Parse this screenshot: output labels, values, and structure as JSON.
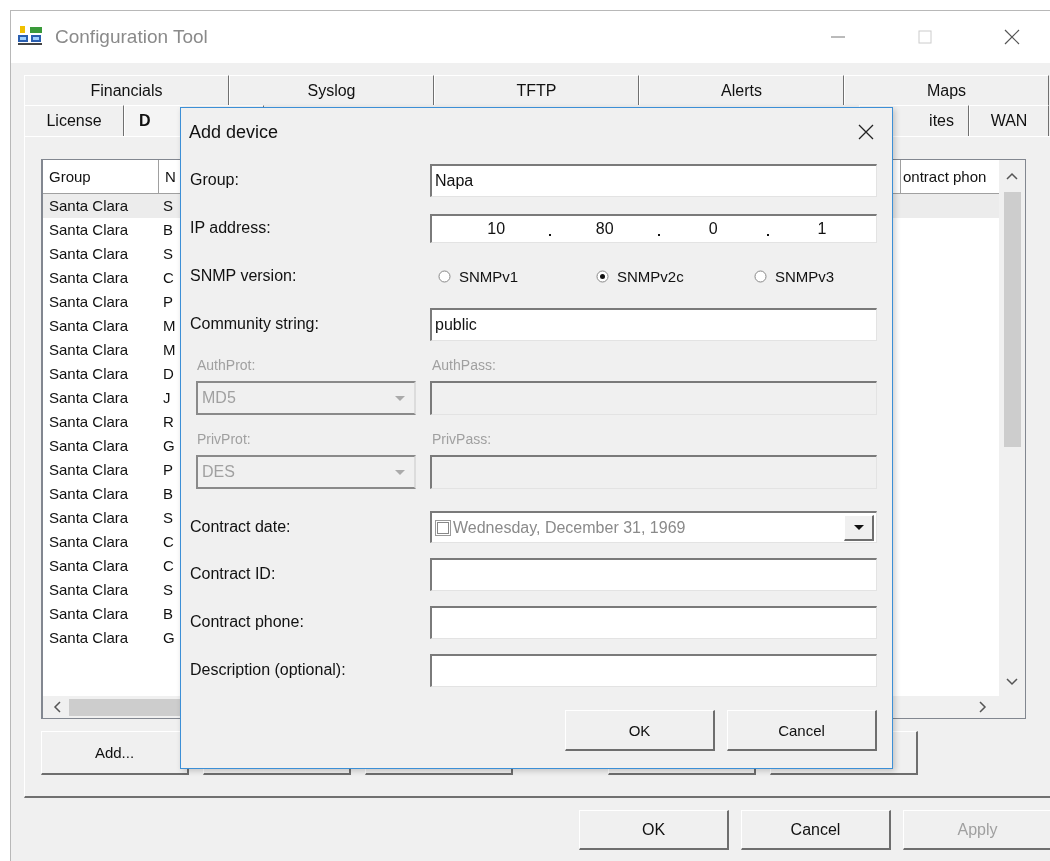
{
  "window": {
    "title": "Configuration Tool"
  },
  "tabs_back_row": [
    {
      "label": "Financials",
      "selected": false
    },
    {
      "label": "Syslog",
      "selected": false
    },
    {
      "label": "TFTP",
      "selected": false
    },
    {
      "label": "Alerts",
      "selected": false
    },
    {
      "label": "Maps",
      "selected": false
    }
  ],
  "tabs_front_row": [
    {
      "label": "License",
      "selected": false
    },
    {
      "label": "D",
      "selected": true
    },
    {
      "label": "ites",
      "selected": false
    },
    {
      "label": "WAN",
      "selected": false
    }
  ],
  "device_list": {
    "columns": [
      "Group",
      "N",
      "ontract phon"
    ],
    "rows": [
      {
        "group": "Santa Clara",
        "name": "S",
        "selected": true
      },
      {
        "group": "Santa Clara",
        "name": "B",
        "selected": false
      },
      {
        "group": "Santa Clara",
        "name": "S",
        "selected": false
      },
      {
        "group": "Santa Clara",
        "name": "C",
        "selected": false
      },
      {
        "group": "Santa Clara",
        "name": "P",
        "selected": false
      },
      {
        "group": "Santa Clara",
        "name": "M",
        "selected": false
      },
      {
        "group": "Santa Clara",
        "name": "M",
        "selected": false
      },
      {
        "group": "Santa Clara",
        "name": "D",
        "selected": false
      },
      {
        "group": "Santa Clara",
        "name": "J",
        "selected": false
      },
      {
        "group": "Santa Clara",
        "name": "R",
        "selected": false
      },
      {
        "group": "Santa Clara",
        "name": "G",
        "selected": false
      },
      {
        "group": "Santa Clara",
        "name": "P",
        "selected": false
      },
      {
        "group": "Santa Clara",
        "name": "B",
        "selected": false
      },
      {
        "group": "Santa Clara",
        "name": "S",
        "selected": false
      },
      {
        "group": "Santa Clara",
        "name": "C",
        "selected": false
      },
      {
        "group": "Santa Clara",
        "name": "C",
        "selected": false
      },
      {
        "group": "Santa Clara",
        "name": "S",
        "selected": false
      },
      {
        "group": "Santa Clara",
        "name": "B",
        "selected": false
      },
      {
        "group": "Santa Clara",
        "name": "G",
        "selected": false
      }
    ]
  },
  "list_buttons": [
    {
      "label": "Add..."
    }
  ],
  "buttons": [
    {
      "label": "OK",
      "disabled": false
    },
    {
      "label": "Cancel",
      "disabled": false
    },
    {
      "label": "Apply",
      "disabled": true
    }
  ],
  "dialog": {
    "title": "Add device",
    "fields": [
      {
        "kind": "text",
        "label": "Group:",
        "value": "Napa"
      },
      {
        "kind": "ip",
        "label": "IP address:",
        "octets": [
          "10",
          "80",
          "0",
          "1"
        ]
      },
      {
        "kind": "radio",
        "label": "SNMP version:",
        "options": [
          {
            "label": "SNMPv1",
            "selected": false
          },
          {
            "label": "SNMPv2c",
            "selected": true
          },
          {
            "label": "SNMPv3",
            "selected": false
          }
        ]
      },
      {
        "kind": "text",
        "label": "Community string:",
        "value": "public"
      },
      {
        "kind": "pair",
        "combo_label": "AuthProt:",
        "combo_value": "MD5",
        "field_label": "AuthPass:",
        "disabled": true
      },
      {
        "kind": "pair",
        "combo_label": "PrivProt:",
        "combo_value": "DES",
        "field_label": "PrivPass:",
        "disabled": true
      },
      {
        "kind": "date",
        "label": "Contract date:",
        "value": "Wednesday, December 31, 1969",
        "checked": false
      },
      {
        "kind": "text",
        "label": "Contract ID:"
      },
      {
        "kind": "text",
        "label": "Contract phone:"
      },
      {
        "kind": "text",
        "label": "Description (optional):"
      }
    ],
    "buttons": [
      {
        "label": "OK"
      },
      {
        "label": "Cancel"
      }
    ]
  }
}
